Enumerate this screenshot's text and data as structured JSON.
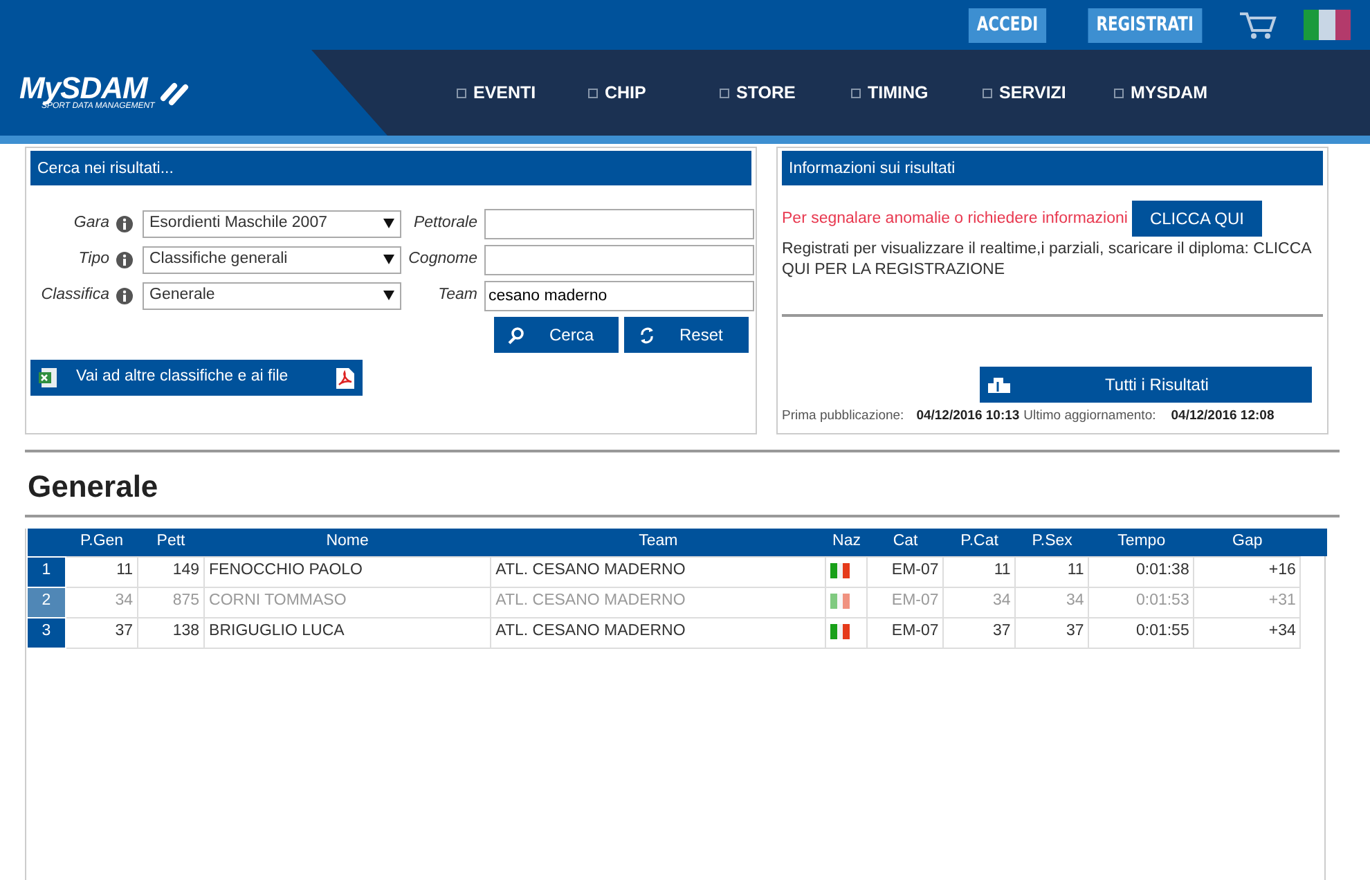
{
  "top_bar": {
    "buttons": [
      "ACCEDI",
      "REGISTRATI"
    ]
  },
  "logo": {
    "name": "MySDAM",
    "tagline": "SPORT DATA MANAGEMENT"
  },
  "nav": {
    "items": [
      "EVENTI",
      "CHIP",
      "STORE",
      "TIMING",
      "SERVIZI",
      "MYSDAM"
    ]
  },
  "search_panel": {
    "title": "Cerca nei risultati...",
    "selects": [
      {
        "label": "Gara",
        "value": "Esordienti Maschile 2007"
      },
      {
        "label": "Tipo",
        "value": "Classifiche generali"
      },
      {
        "label": "Classifica",
        "value": "Generale"
      }
    ],
    "inputs": [
      {
        "label": "Pettorale"
      },
      {
        "label": "Cognome"
      },
      {
        "label": "Team",
        "value": "cesano maderno"
      }
    ],
    "buttons": [
      "Cerca",
      "Reset"
    ],
    "files_button": "Vai ad altre classifiche e ai file"
  },
  "info_panel": {
    "title": "Informazioni sui risultati",
    "notice": "Per segnalare anomalie o richiedere informazioni",
    "notice_button": "CLICCA QUI",
    "register_text": "Registrati per visualizzare il realtime,i parziali, scaricare il diploma: CLICCA QUI PER LA REGISTRAZIONE",
    "all_results_button": "Tutti i Risultati",
    "first_published_label": "Prima pubblicazione:",
    "first_published": "04/12/2016 10:13",
    "last_update_label": "Ultimo aggiornamento:",
    "last_update": "04/12/2016 12:08"
  },
  "section_title": "Generale",
  "table": {
    "columns": [
      "P.Gen",
      "Pett",
      "Nome",
      "Team",
      "Naz",
      "Cat",
      "P.Cat",
      "P.Sex",
      "Tempo",
      "Gap"
    ],
    "rows": [
      {
        "rank": "1",
        "cells": [
          "11",
          "149",
          "FENOCCHIO PAOLO",
          "ATL. CESANO MADERNO",
          "",
          "EM-07",
          "11",
          "11",
          "0:01:38",
          "+16"
        ],
        "highlighted": false
      },
      {
        "rank": "2",
        "cells": [
          "34",
          "875",
          "CORNI TOMMASO",
          "ATL. CESANO MADERNO",
          "",
          "EM-07",
          "34",
          "34",
          "0:01:53",
          "+31"
        ],
        "highlighted": true
      },
      {
        "rank": "3",
        "cells": [
          "37",
          "138",
          "BRIGUGLIO LUCA",
          "ATL. CESANO MADERNO",
          "",
          "EM-07",
          "37",
          "37",
          "0:01:55",
          "+34"
        ],
        "highlighted": false
      }
    ]
  }
}
